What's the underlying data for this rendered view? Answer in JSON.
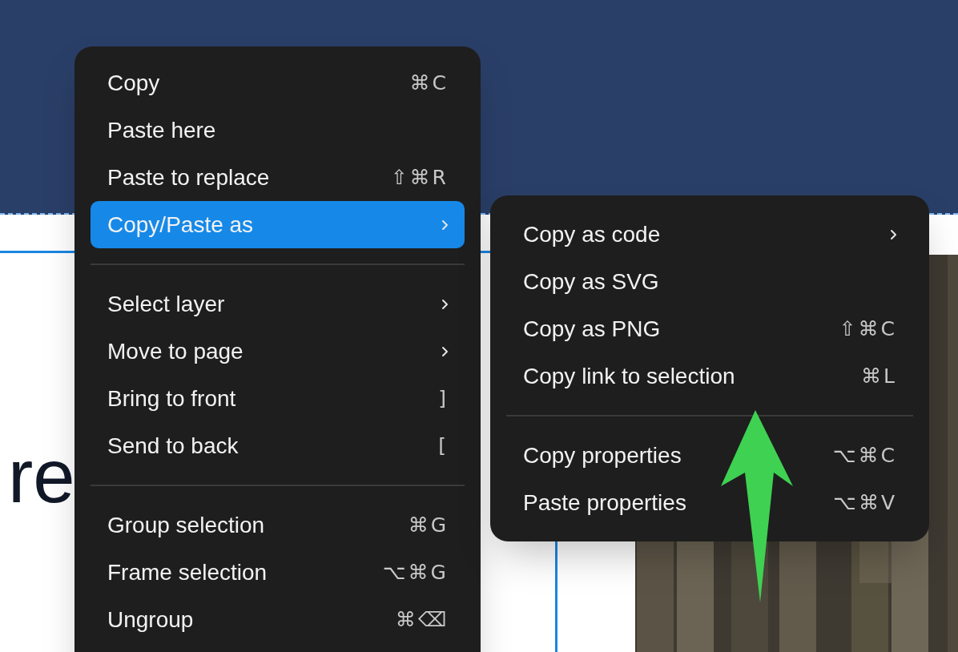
{
  "canvas": {
    "body_text": "re"
  },
  "context_menu": {
    "items": [
      {
        "kind": "item",
        "label": "Copy",
        "shortcut": "⌘C",
        "has_submenu": false,
        "selected": false
      },
      {
        "kind": "item",
        "label": "Paste here",
        "has_submenu": false,
        "selected": false
      },
      {
        "kind": "item",
        "label": "Paste to replace",
        "shortcut": "⇧⌘R",
        "has_submenu": false,
        "selected": false
      },
      {
        "kind": "item",
        "label": "Copy/Paste as",
        "has_submenu": true,
        "selected": true
      },
      {
        "kind": "separator"
      },
      {
        "kind": "item",
        "label": "Select layer",
        "has_submenu": true,
        "selected": false
      },
      {
        "kind": "item",
        "label": "Move to page",
        "has_submenu": true,
        "selected": false
      },
      {
        "kind": "item",
        "label": "Bring to front",
        "shortcut": "]",
        "has_submenu": false,
        "selected": false
      },
      {
        "kind": "item",
        "label": "Send to back",
        "shortcut": "[",
        "has_submenu": false,
        "selected": false
      },
      {
        "kind": "separator"
      },
      {
        "kind": "item",
        "label": "Group selection",
        "shortcut": "⌘G",
        "has_submenu": false,
        "selected": false
      },
      {
        "kind": "item",
        "label": "Frame selection",
        "shortcut": "⌥⌘G",
        "has_submenu": false,
        "selected": false
      },
      {
        "kind": "item",
        "label": "Ungroup",
        "shortcut": "⌘⌫",
        "has_submenu": false,
        "selected": false
      }
    ]
  },
  "submenu": {
    "items": [
      {
        "kind": "item",
        "label": "Copy as code",
        "has_submenu": true,
        "selected": false
      },
      {
        "kind": "item",
        "label": "Copy as SVG",
        "has_submenu": false,
        "selected": false
      },
      {
        "kind": "item",
        "label": "Copy as PNG",
        "shortcut": "⇧⌘C",
        "has_submenu": false,
        "selected": false
      },
      {
        "kind": "item",
        "label": "Copy link to selection",
        "shortcut": "⌘L",
        "has_submenu": false,
        "selected": false
      },
      {
        "kind": "separator"
      },
      {
        "kind": "item",
        "label": "Copy properties",
        "shortcut": "⌥⌘C",
        "has_submenu": false,
        "selected": false
      },
      {
        "kind": "item",
        "label": "Paste properties",
        "shortcut": "⌥⌘V",
        "has_submenu": false,
        "selected": false
      }
    ]
  }
}
